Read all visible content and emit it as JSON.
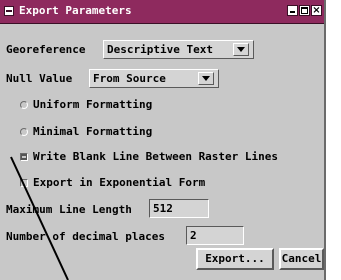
{
  "window": {
    "title": "Export Parameters"
  },
  "fields": {
    "georeference": {
      "label": "Georeference",
      "value": "Descriptive Text"
    },
    "null_value": {
      "label": "Null Value",
      "value": "From Source"
    },
    "max_line_length": {
      "label": "Maximum Line Length",
      "value": "512"
    },
    "decimal_places": {
      "label": "Number of decimal places",
      "value": "2"
    }
  },
  "options": {
    "uniform": {
      "label": "Uniform Formatting",
      "type": "radio",
      "checked": false
    },
    "minimal": {
      "label": "Minimal Formatting",
      "type": "radio",
      "checked": false
    },
    "blank_line": {
      "label": "Write Blank Line Between Raster Lines",
      "type": "checkbox",
      "checked": true
    },
    "exponential": {
      "label": "Export in Exponential Form",
      "type": "checkbox",
      "checked": false
    }
  },
  "buttons": {
    "export": "Export...",
    "cancel": "Cancel"
  },
  "icons": {
    "window_menu": "window-menu-icon",
    "minimize": "minimize-icon",
    "maximize": "maximize-icon",
    "close": "close-icon"
  },
  "colors": {
    "titlebar": "#8e2a5e",
    "panel": "#c8c8c8"
  }
}
